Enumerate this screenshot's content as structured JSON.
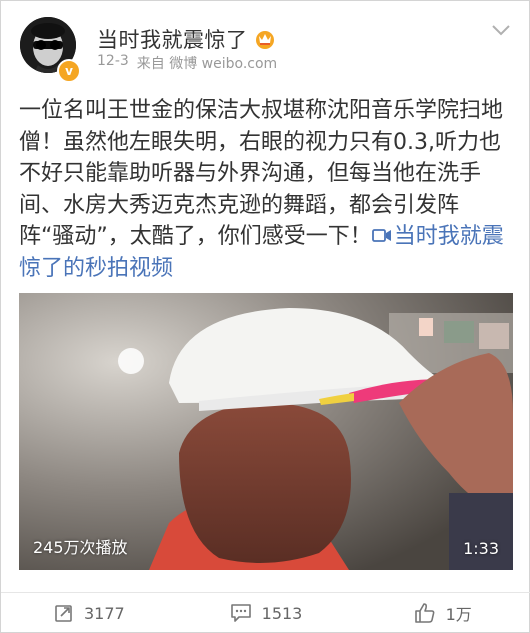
{
  "post": {
    "author": "当时我就震惊了",
    "time": "12-3",
    "source_prefix": "来自",
    "source": "微博 weibo.com",
    "text": "一位名叫王世金的保洁大叔堪称沈阳音乐学院扫地僧！虽然他左眼失明，右眼的视力只有0.3,听力也不好只能靠助听器与外界沟通，但每当他在洗手间、水房大秀迈克杰克逊的舞蹈，都会引发阵阵“骚动”，太酷了，你们感受一下！",
    "link_text": "当时我就震惊了的秒拍视频",
    "verified_badge": "v"
  },
  "video": {
    "play_count": "245万次播放",
    "duration": "1:33"
  },
  "actions": {
    "repost_count": "3177",
    "comment_count": "1513",
    "like_count": "1万"
  },
  "colors": {
    "link": "#4a74b8",
    "verified": "#f5a623",
    "text": "#333333",
    "meta": "#999999"
  }
}
